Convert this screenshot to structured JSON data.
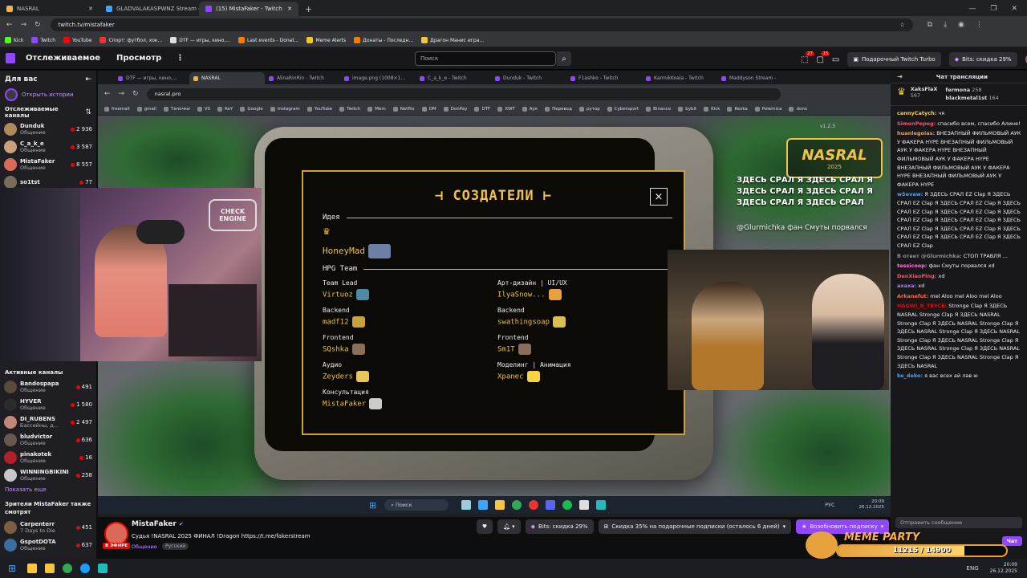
{
  "outer_browser": {
    "tabs": [
      {
        "title": "NASRAL",
        "color": "#f0b24a"
      },
      {
        "title": "GLADVALAKASPWNZ Stream -",
        "color": "#3ea6ff"
      },
      {
        "title": "(15) MistaFaker - Twitch",
        "color": "#9146ff"
      }
    ],
    "url": "twitch.tv/mistafaker",
    "bookmarks": [
      "Kick",
      "Twitch",
      "YouTube",
      "Спорт: футбол, хок...",
      "DTF — игры, кино,...",
      "Last events - Donat...",
      "Meme Alerts",
      "Донаты - Последн...",
      "Драгон Манис игра..."
    ]
  },
  "twitch_nav": {
    "following": "Отслеживаемое",
    "browse": "Просмотр",
    "search_placeholder": "Поиск",
    "notif_count_1": "27",
    "notif_count_2": "15",
    "gift_turbo": "Подарочный Twitch Turbo",
    "bits_discount": "Bits: скидка 29%"
  },
  "sidebar": {
    "for_you": "Для вас",
    "open_stories": "Открыть истории",
    "followed_header": "Отслеживаемые каналы",
    "followed": [
      {
        "name": "Dunduk",
        "game": "Общение",
        "viewers": "2 936",
        "color": "#b08a5a"
      },
      {
        "name": "C_a_k_e",
        "game": "Общение",
        "viewers": "3 587",
        "color": "#c9a27c"
      },
      {
        "name": "MistaFaker",
        "game": "Общение",
        "viewers": "8 557",
        "color": "#d86b57"
      },
      {
        "name": "so1tst",
        "game": "",
        "viewers": "77",
        "color": "#7a6d5a"
      }
    ],
    "active_header": "Активные каналы",
    "active": [
      {
        "name": "Bandospapa",
        "game": "Общение",
        "viewers": "491",
        "color": "#5a4a3a"
      },
      {
        "name": "HYVER",
        "game": "Общение",
        "viewers": "1 580",
        "color": "#2b2b2b"
      },
      {
        "name": "DI_RUBENS",
        "game": "Бассейны, д...",
        "viewers": "2 497",
        "color": "#c2877a"
      },
      {
        "name": "bludvictor",
        "game": "Общение",
        "viewers": "636",
        "color": "#6a5850"
      },
      {
        "name": "pinakotek",
        "game": "Общение",
        "viewers": "16",
        "color": "#b0202a"
      },
      {
        "name": "WINNINGBIKINI",
        "game": "Общение",
        "viewers": "258",
        "color": "#c7c7c7"
      }
    ],
    "show_more": "Показать еще",
    "also_watch": "Зрители MistaFaker также смотрят",
    "also": [
      {
        "name": "Carpenterr",
        "game": "7 Days to Die",
        "viewers": "451",
        "color": "#7b5f3f"
      },
      {
        "name": "GspotDOTA",
        "game": "Общение",
        "viewers": "637",
        "color": "#3b6ea0"
      }
    ]
  },
  "inner_browser": {
    "tabs": [
      "DTF — игры, кино,...",
      "NASRAL",
      "AlinaRinRin - Twitch",
      "image.png (1008×1...",
      "C_a_k_e - Twitch",
      "Dunduk - Twitch",
      "F1ashko - Twitch",
      "KarmikKoala - Twitch",
      "Maddyson Stream -"
    ],
    "url": "nasral.pro",
    "bookmarks": [
      "freemail",
      "gmail",
      "Тапочки",
      "VS",
      "ReY",
      "Google",
      "Instagram",
      "YouTube",
      "Twitch",
      "Mem",
      "Netflix",
      "DM",
      "DonPay",
      "DTF",
      "XWT",
      "Аук",
      "Перевод",
      "рутор",
      "Cybersport",
      "Binance",
      "bybit",
      "Kick",
      "Rezka",
      "Polemica",
      "donx"
    ]
  },
  "site": {
    "logo": "NASRAL",
    "logo_year": "2025",
    "version": "v1.2.3",
    "overlay_text": "ЗДЕСЬ СРАЛ Я ЗДЕСЬ СРАЛ Я ЗДЕСЬ СРАЛ Я ЗДЕСЬ СРАЛ Я ЗДЕСЬ СРАЛ Я ЗДЕСЬ СРАЛ",
    "overlay_donor": "@Glurmichka фан Смуты порвался",
    "cam_label": "CHECK ENGINE"
  },
  "credits": {
    "title": "СОЗДАТЕЛИ",
    "close": "×",
    "idea_label": "Идея",
    "idea_name": "HoneyMad",
    "team_label": "HPG Team",
    "left": [
      {
        "role": "Team Lead",
        "name": "Virtuoz"
      },
      {
        "role": "Backend",
        "name": "madf12"
      },
      {
        "role": "Frontend",
        "name": "SQshka"
      },
      {
        "role": "Аудио",
        "name": "Zeyders"
      },
      {
        "role": "Консультация",
        "name": "MistaFaker"
      }
    ],
    "right": [
      {
        "role": "Арт-дизайн | UI/UX",
        "name": "IlyaSnow..."
      },
      {
        "role": "Backend",
        "name": "swathingsoap"
      },
      {
        "role": "Frontend",
        "name": "Sm1T"
      },
      {
        "role": "Моделинг | Анимация",
        "name": "Xpanec"
      }
    ]
  },
  "inner_taskbar": {
    "search": "Поиск",
    "lang": "РУС",
    "time": "20:09",
    "date": "26.12.2025"
  },
  "stream_info": {
    "streamer": "MistaFaker",
    "live": "В ЭФИРЕ",
    "title": "Судья !NASRAL 2025 ФИНАЛ !Dragon https://t.me/fakerstream",
    "category": "Общение",
    "tag": "Русский",
    "bits_discount": "Bits: скидка 29%",
    "sub_discount": "Скидка 35% на подарочные подписки (осталось 6 дней)",
    "resub": "Возобновить подписку"
  },
  "chat": {
    "header": "Чат трансляции",
    "top": [
      {
        "name": "XaksFlaX",
        "count": "567"
      },
      {
        "name": "fermona",
        "count": "258"
      },
      {
        "name": "blackmetal1st",
        "count": "164"
      }
    ],
    "messages": [
      {
        "user": "cannyCatych:",
        "color": "#f5d442",
        "text": "чя"
      },
      {
        "user": "SimonPepeg:",
        "color": "#ff4d6d",
        "text": "спасибо всем, спасибо Алине!"
      },
      {
        "user": "huanlegoias:",
        "color": "#f0a050",
        "text": "ВНЕЗАПНЫЙ ФИЛЬМОВЫЙ АУК У ФАКЕРА HYPE ВНЕЗАПНЫЙ ФИЛЬМОВЫЙ АУК У ФАКЕРА HYPE ВНЕЗАПНЫЙ ФИЛЬМОВЫЙ АУК У ФАКЕРА HYPE ВНЕЗАПНЫЙ ФИЛЬМОВЫЙ АУК У ФАКЕРА HYPE ВНЕЗАПНЫЙ ФИЛЬМОВЫЙ АУК У ФАКЕРА HYPE"
      },
      {
        "user": "wSevaw:",
        "color": "#3ea6ff",
        "text": "Я ЗДЕСЬ СРАЛ EZ Clap Я ЗДЕСЬ СРАЛ EZ Clap Я ЗДЕСЬ СРАЛ EZ Clap Я ЗДЕСЬ СРАЛ EZ Clap Я ЗДЕСЬ СРАЛ EZ Clap Я ЗДЕСЬ СРАЛ EZ Clap Я ЗДЕСЬ СРАЛ EZ Clap Я ЗДЕСЬ СРАЛ EZ Clap Я ЗДЕСЬ СРАЛ EZ Clap Я ЗДЕСЬ СРАЛ EZ Clap Я ЗДЕСЬ СРАЛ EZ Clap Я ЗДЕСЬ СРАЛ EZ Clap"
      },
      {
        "user": "В ответ @Glurmichka:",
        "color": "#8f8f99",
        "text": "СТОП ТРАВЛЯ ..."
      },
      {
        "user": "tessicoop:",
        "color": "#ff7ad9",
        "text": "фан Смуты порвался xd"
      },
      {
        "user": "DenXiaoPing:",
        "color": "#ff4d6d",
        "text": "xd"
      },
      {
        "user": "axaxa:",
        "color": "#b07aff",
        "text": "xd"
      },
      {
        "user": "Arkanefut:",
        "color": "#ff6a3d",
        "text": "mel Aloo mel Aloo mel Aloo"
      },
      {
        "user": "HAGWI_B_TRYCE:",
        "color": "#eb0400",
        "text": "Stronge Clap Я ЗДЕСЬ NASRAL Stronge Clap Я ЗДЕСЬ NASRAL Stronge Clap Я ЗДЕСЬ NASRAL Stronge Clap Я ЗДЕСЬ NASRAL Stronge Clap Я ЗДЕСЬ NASRAL Stronge Clap Я ЗДЕСЬ NASRAL Stronge Clap Я ЗДЕСЬ NASRAL Stronge Clap Я ЗДЕСЬ NASRAL Stronge Clap Я ЗДЕСЬ NASRAL Stronge Clap Я ЗДЕСЬ NASRAL"
      },
      {
        "user": "ke_deko:",
        "color": "#3ea6ff",
        "text": "я вас всех ай лав ю"
      }
    ],
    "input_placeholder": "Отправить сообщение",
    "chat_button": "Чат"
  },
  "overlay": {
    "title": "MEME PARTY",
    "progress": "11215 / 14900"
  },
  "windows_taskbar": {
    "lang": "ENG",
    "time": "20:09",
    "date": "26.12.2025"
  }
}
